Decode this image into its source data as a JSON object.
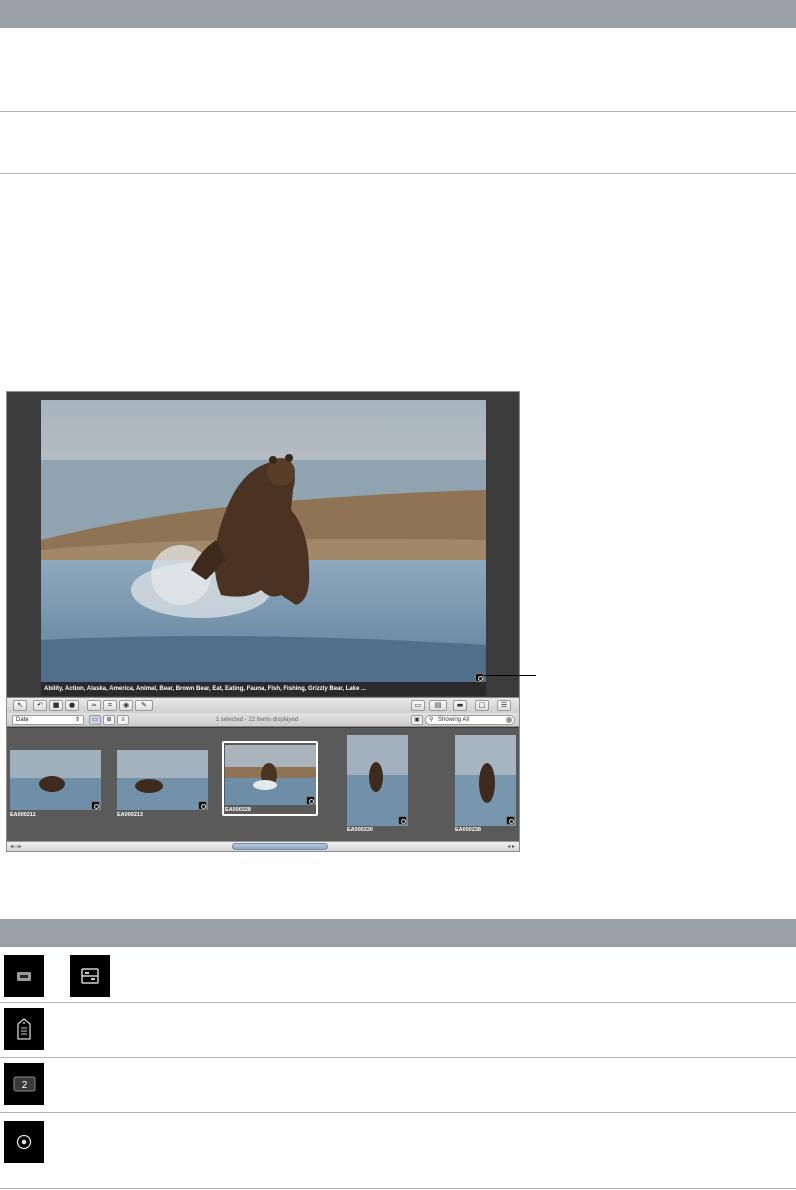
{
  "keywords_strip": "Ability, Action, Alaska, America, Animal, Bear, Brown Bear, Eat, Eating, Fauna, Fish, Fishing, Grizzly Bear, Lake ...",
  "filter": {
    "sort_by": "Date",
    "status": "1 selected - 22 items displayed",
    "search_value": "Showing All"
  },
  "thumbnails": [
    {
      "label": "EA000211",
      "selected": false
    },
    {
      "label": "EA000213",
      "selected": false
    },
    {
      "label": "EA000228",
      "selected": true
    },
    {
      "label": "EA000230",
      "selected": false
    },
    {
      "label": "EA000238",
      "selected": false
    }
  ],
  "icons": [
    {
      "name": "viewer-button-icon"
    },
    {
      "name": "browser-split-button-icon"
    },
    {
      "name": "metadata-tag-icon"
    },
    {
      "name": "stack-count-icon",
      "text": "2"
    },
    {
      "name": "target-circle-icon"
    }
  ],
  "colors": {
    "header_bar": "#9aa0a8",
    "viewer_bg": "#3b3b3b",
    "browser_bg": "#5a5a5a",
    "selection": "#ffffff",
    "scroll_thumb": "#9fb3d0"
  }
}
